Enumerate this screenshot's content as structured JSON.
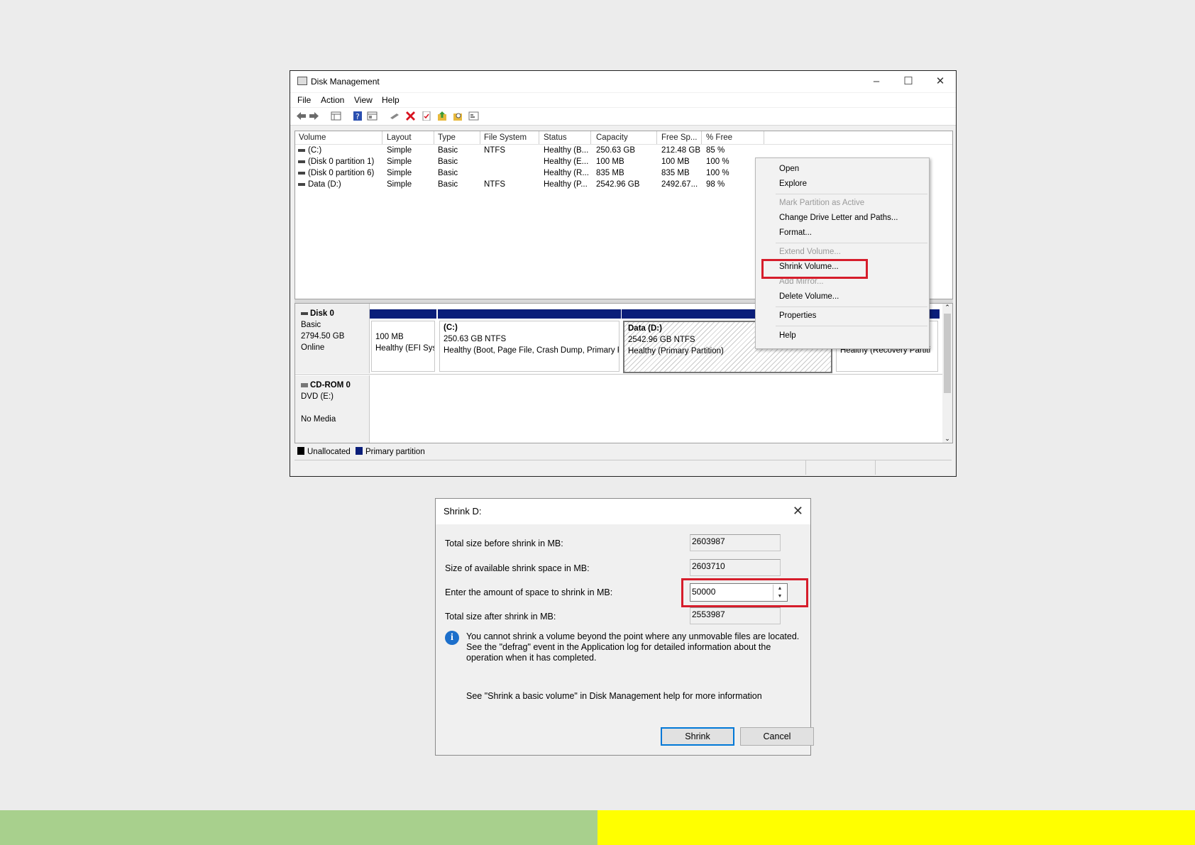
{
  "window": {
    "title": "Disk Management",
    "menu": [
      "File",
      "Action",
      "View",
      "Help"
    ],
    "controls": {
      "minimize": "–",
      "maximize": "☐",
      "close": "✕"
    }
  },
  "volume_table": {
    "columns": [
      "Volume",
      "Layout",
      "Type",
      "File System",
      "Status",
      "Capacity",
      "Free Sp...",
      "% Free"
    ],
    "rows": [
      [
        "(C:)",
        "Simple",
        "Basic",
        "NTFS",
        "Healthy (B...",
        "250.63 GB",
        "212.48 GB",
        "85 %"
      ],
      [
        "(Disk 0 partition 1)",
        "Simple",
        "Basic",
        "",
        "Healthy (E...",
        "100 MB",
        "100 MB",
        "100 %"
      ],
      [
        "(Disk 0 partition 6)",
        "Simple",
        "Basic",
        "",
        "Healthy (R...",
        "835 MB",
        "835 MB",
        "100 %"
      ],
      [
        "Data (D:)",
        "Simple",
        "Basic",
        "NTFS",
        "Healthy (P...",
        "2542.96 GB",
        "2492.67...",
        "98 %"
      ]
    ]
  },
  "disk0": {
    "name": "Disk 0",
    "type": "Basic",
    "size": "2794.50 GB",
    "status": "Online",
    "partitions": [
      {
        "title": "",
        "size": "100 MB",
        "health": "Healthy (EFI Sys"
      },
      {
        "title": "(C:)",
        "size": "250.63 GB NTFS",
        "health": "Healthy (Boot, Page File, Crash Dump, Primary P"
      },
      {
        "title": "Data  (D:)",
        "size": "2542.96 GB NTFS",
        "health": "Healthy (Primary Partition)"
      },
      {
        "title": "",
        "size": "",
        "health": "Healthy (Recovery Partiti"
      }
    ]
  },
  "cdrom": {
    "name": "CD-ROM 0",
    "type": "DVD (E:)",
    "status": "No Media"
  },
  "legend": {
    "unallocated": "Unallocated",
    "primary": "Primary partition"
  },
  "colors": {
    "primary_partition": "#0a1e7a",
    "highlight": "#d61d2b",
    "accent": "#0078d7"
  },
  "context_menu": {
    "open": "Open",
    "explore": "Explore",
    "mark_active": "Mark Partition as Active",
    "change_letter": "Change Drive Letter and Paths...",
    "format": "Format...",
    "extend": "Extend Volume...",
    "shrink": "Shrink Volume...",
    "add_mirror": "Add Mirror...",
    "delete": "Delete Volume...",
    "properties": "Properties",
    "help": "Help"
  },
  "shrink_dialog": {
    "title": "Shrink D:",
    "total_before_label": "Total size before shrink in MB:",
    "total_before": "2603987",
    "available_label": "Size of available shrink space in MB:",
    "available": "2603710",
    "amount_label": "Enter the amount of space to shrink in MB:",
    "amount": "50000",
    "total_after_label": "Total size after shrink in MB:",
    "total_after": "2553987",
    "info": "You cannot shrink a volume beyond the point where any unmovable files are located. See the \"defrag\" event in the Application log for detailed information about the operation when it has completed.",
    "help": "See \"Shrink a basic volume\" in Disk Management help for more information",
    "shrink_button": "Shrink",
    "cancel_button": "Cancel"
  },
  "bottom_bars": {
    "left_color": "#a8d08d",
    "right_color": "#ffff00"
  }
}
